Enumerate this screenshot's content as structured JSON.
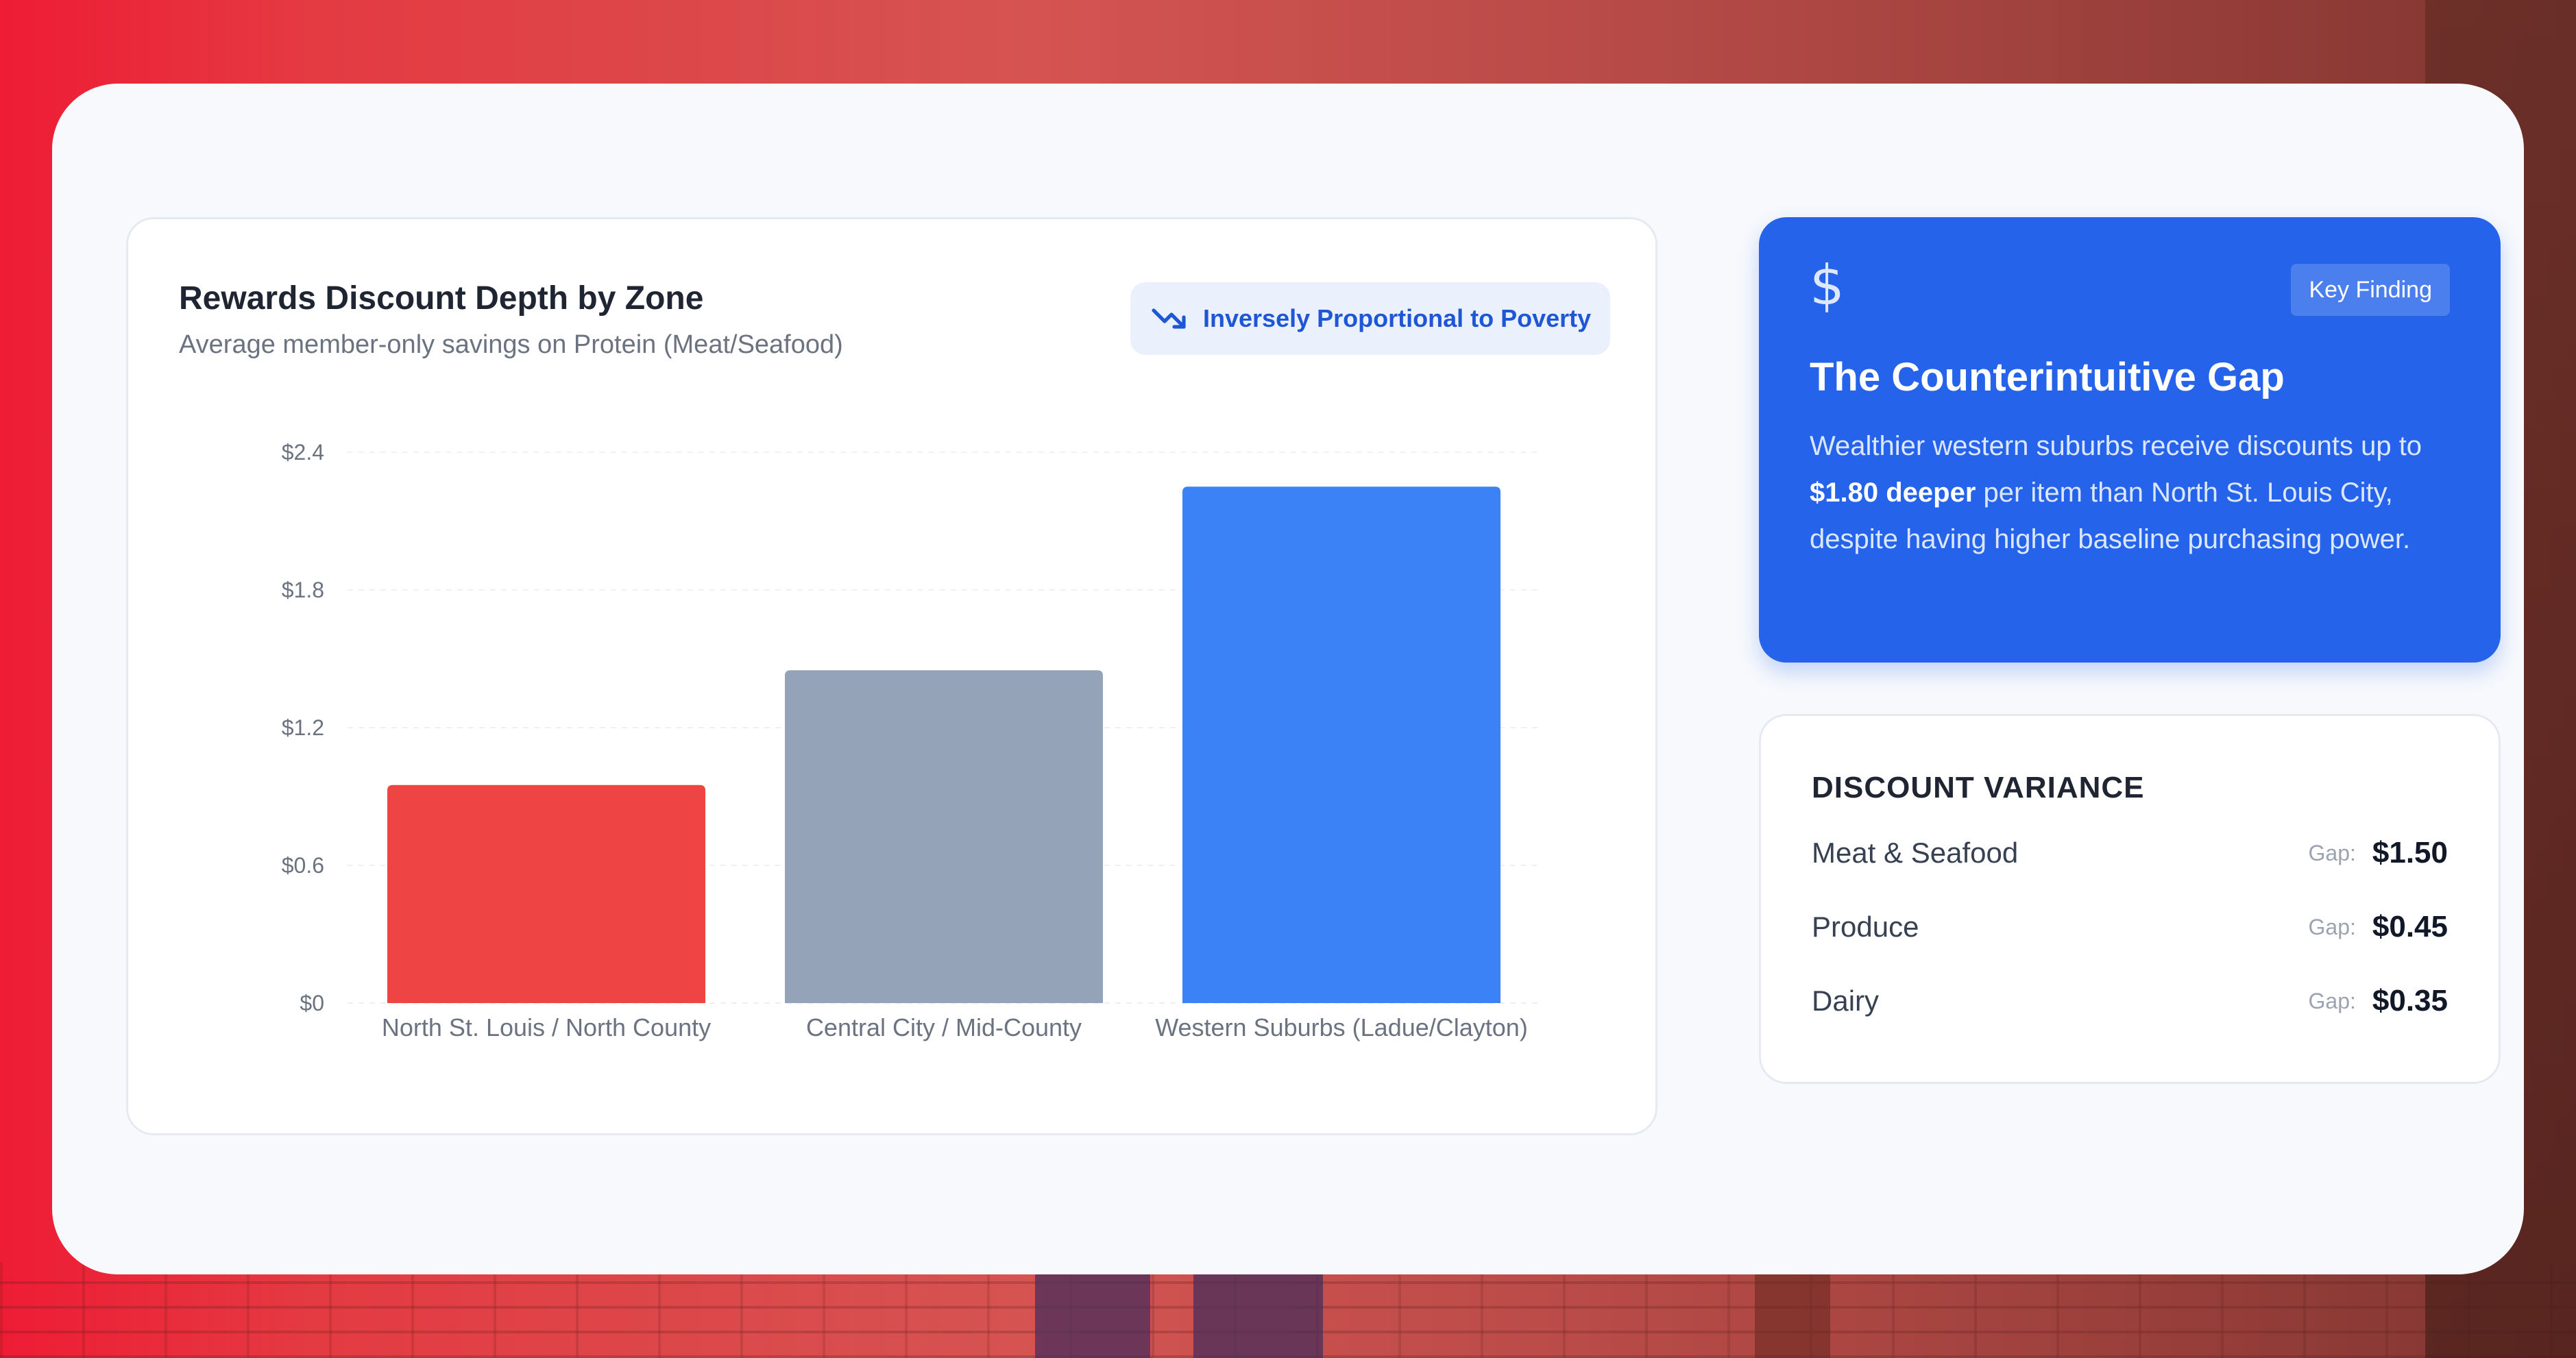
{
  "chart_card": {
    "title": "Rewards Discount Depth by Zone",
    "subtitle": "Average member-only savings on Protein (Meat/Seafood)",
    "badge": "Inversely Proportional to Poverty"
  },
  "chart_data": {
    "type": "bar",
    "title": "Rewards Discount Depth by Zone",
    "subtitle": "Average member-only savings on Protein (Meat/Seafood)",
    "categories": [
      "North St. Louis / North County",
      "Central City / Mid-County",
      "Western Suburbs (Ladue/Clayton)"
    ],
    "values": [
      0.95,
      1.45,
      2.25
    ],
    "colors": [
      "#ef4444",
      "#94a3b8",
      "#3b82f6"
    ],
    "ylim": [
      0,
      2.4
    ],
    "yticks": [
      0,
      0.6,
      1.2,
      1.8,
      2.4
    ],
    "ytick_labels": [
      "$0",
      "$0.6",
      "$1.2",
      "$1.8",
      "$2.4"
    ],
    "xlabel": "",
    "ylabel": "",
    "grid": true,
    "legend": "none"
  },
  "finding": {
    "tag": "Key Finding",
    "icon": "dollar-icon",
    "title": "The Counterintuitive Gap",
    "body_pre": "Wealthier western suburbs receive discounts up to ",
    "body_bold": "$1.80 deeper",
    "body_post": " per item than North St. Louis City, despite having higher baseline purchasing power."
  },
  "variance": {
    "title": "DISCOUNT VARIANCE",
    "gap_label": "Gap:",
    "rows": [
      {
        "category": "Meat & Seafood",
        "gap": "$1.50"
      },
      {
        "category": "Produce",
        "gap": "$0.45"
      },
      {
        "category": "Dairy",
        "gap": "$0.35"
      }
    ]
  },
  "colors": {
    "accent": "#2563eb",
    "card_bg": "#ffffff",
    "panel_bg": "#f7f9fc"
  }
}
